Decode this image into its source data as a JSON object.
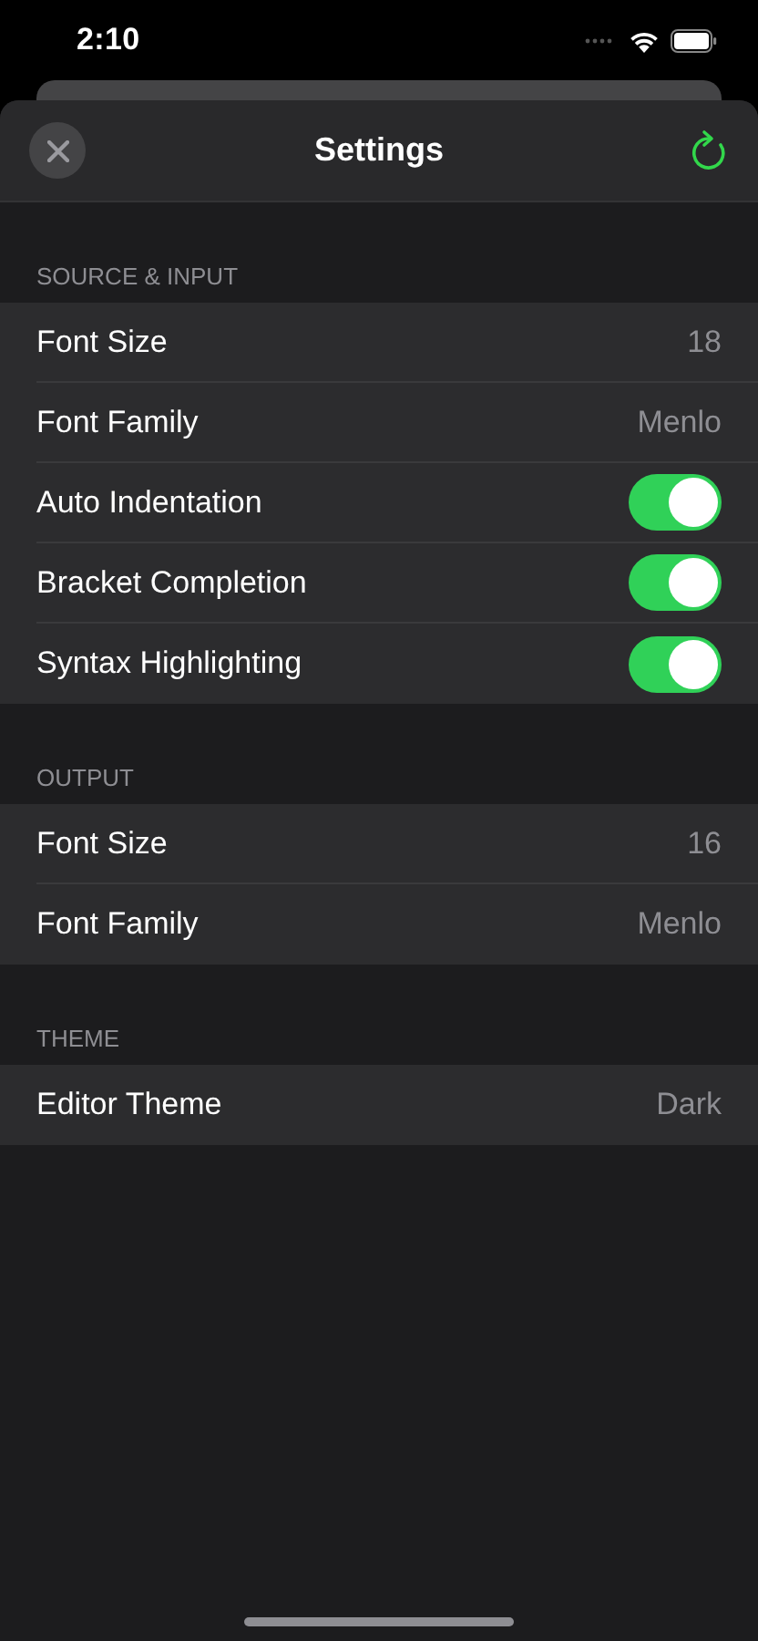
{
  "status_bar": {
    "time": "2:10"
  },
  "nav": {
    "title": "Settings"
  },
  "sections": [
    {
      "header": "SOURCE & INPUT",
      "rows": [
        {
          "kind": "value",
          "label": "Font Size",
          "value": "18"
        },
        {
          "kind": "value",
          "label": "Font Family",
          "value": "Menlo"
        },
        {
          "kind": "toggle",
          "label": "Auto Indentation",
          "on": true
        },
        {
          "kind": "toggle",
          "label": "Bracket Completion",
          "on": true
        },
        {
          "kind": "toggle",
          "label": "Syntax Highlighting",
          "on": true
        }
      ]
    },
    {
      "header": "OUTPUT",
      "rows": [
        {
          "kind": "value",
          "label": "Font Size",
          "value": "16"
        },
        {
          "kind": "value",
          "label": "Font Family",
          "value": "Menlo"
        }
      ]
    },
    {
      "header": "THEME",
      "rows": [
        {
          "kind": "value",
          "label": "Editor Theme",
          "value": "Dark"
        }
      ]
    }
  ]
}
